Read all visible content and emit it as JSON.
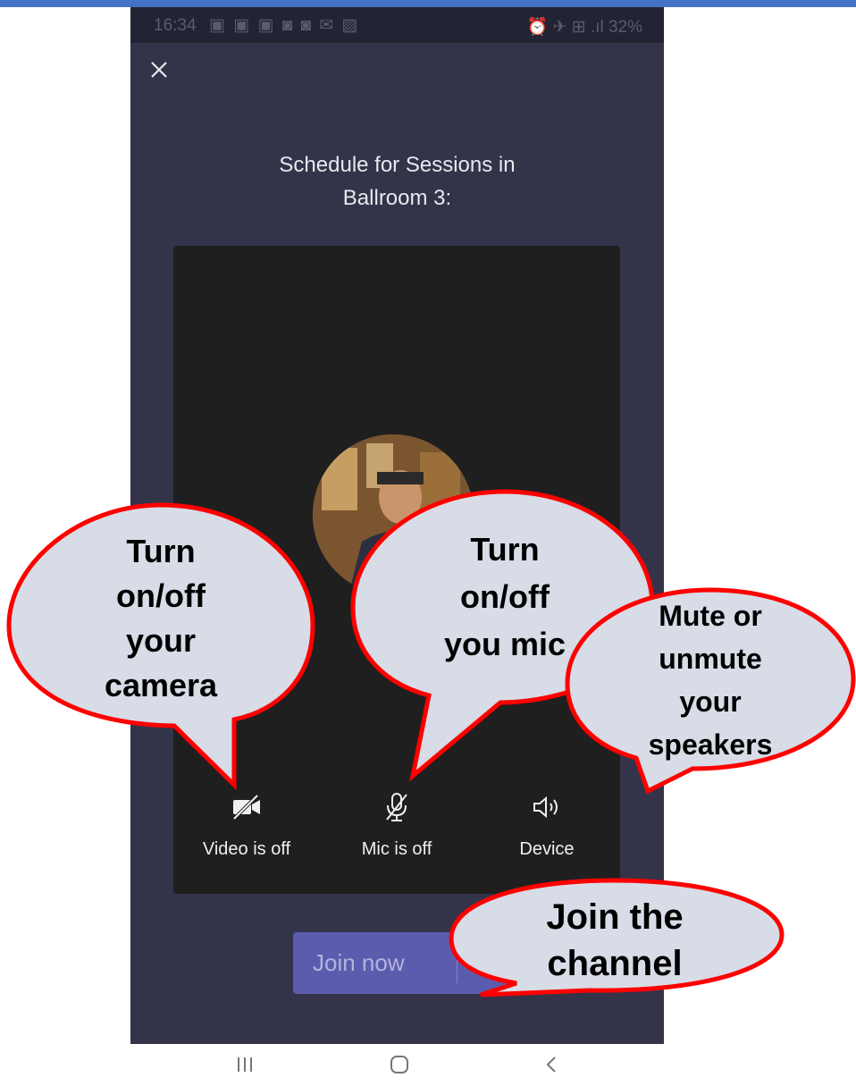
{
  "status_bar": {
    "time": "16:34",
    "notification_icons": "▣ ▣ ▣ ◙ ◙ ✉ ▨",
    "battery": "⏰ ✈ ⊞ .ıl 32%"
  },
  "meeting": {
    "title_lines": [
      "Schedule for Sessions in",
      "Ballroom 3:"
    ]
  },
  "controls": {
    "video": {
      "label": "Video is off",
      "icon": "video-off-icon"
    },
    "mic": {
      "label": "Mic is off",
      "icon": "mic-off-icon"
    },
    "device": {
      "label": "Device",
      "icon": "speaker-icon"
    }
  },
  "join_button": {
    "label": "Join now"
  },
  "callouts": {
    "camera": [
      "Turn",
      "on/off",
      "your",
      "camera"
    ],
    "mic": [
      "Turn",
      "on/off",
      "you mic"
    ],
    "speakers": [
      "Mute or",
      "unmute",
      "your",
      "speakers"
    ],
    "join": [
      "Join the",
      "channel"
    ]
  },
  "nav_bar": {
    "recents_icon": "recents-icon",
    "home_icon": "home-icon",
    "back_icon": "back-icon"
  },
  "colors": {
    "accent_bar": "#4472c4",
    "app_background": "#33344a",
    "join_button": "#5b5cad",
    "callout_fill": "#d7dce6",
    "callout_border": "#ff0000"
  }
}
